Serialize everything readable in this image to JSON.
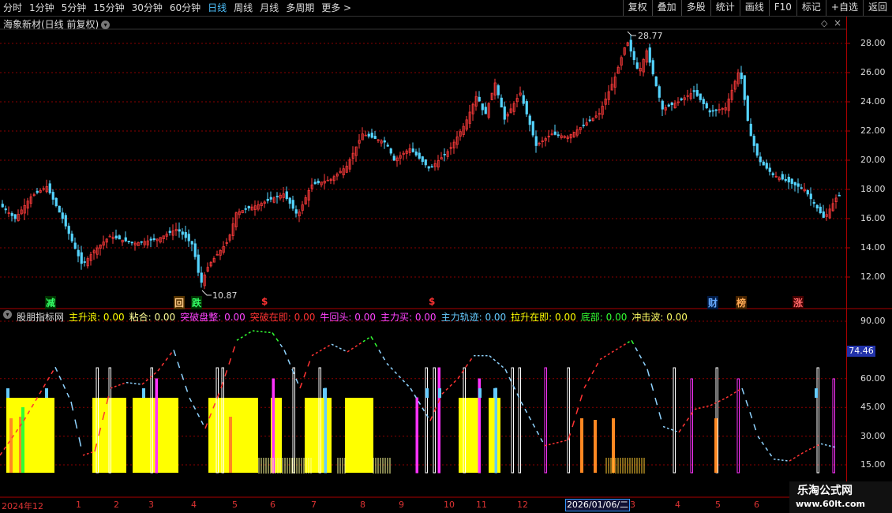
{
  "toolbar": {
    "periods": [
      "分时",
      "1分钟",
      "5分钟",
      "15分钟",
      "30分钟",
      "60分钟",
      "日线",
      "周线",
      "月线",
      "多周期",
      "更多 >"
    ],
    "active": "日线",
    "buttons": [
      "复权",
      "叠加",
      "多股",
      "统计",
      "画线",
      "F10",
      "标记",
      "+自选",
      "返回"
    ]
  },
  "stock": {
    "title": "海象新材(日线 前复权)",
    "high_label": "28.77",
    "low_label": "10.87"
  },
  "price_axis": [
    "28.00",
    "26.00",
    "24.00",
    "22.00",
    "20.00",
    "18.00",
    "16.00",
    "14.00",
    "12.00"
  ],
  "indicator": {
    "name": "股朋指标网",
    "params": [
      {
        "label": "主升浪:",
        "value": "0.00",
        "color": "#ffff00"
      },
      {
        "label": "粘合:",
        "value": "0.00",
        "color": "#ffff99"
      },
      {
        "label": "突破盘整:",
        "value": "0.00",
        "color": "#ff44ff"
      },
      {
        "label": "突破在即:",
        "value": "0.00",
        "color": "#ff3333"
      },
      {
        "label": "牛回头:",
        "value": "0.00",
        "color": "#ff44ff"
      },
      {
        "label": "主力买:",
        "value": "0.00",
        "color": "#ff44ff"
      },
      {
        "label": "主力轨迹:",
        "value": "0.00",
        "color": "#66ccff"
      },
      {
        "label": "拉升在即:",
        "value": "0.00",
        "color": "#ffff00"
      },
      {
        "label": "底部:",
        "value": "0.00",
        "color": "#33ff33"
      },
      {
        "label": "冲击波:",
        "value": "0.00",
        "color": "#ffff66"
      }
    ],
    "axis": [
      "90.00",
      "60.00",
      "45.00",
      "30.00",
      "15.00"
    ],
    "current": "74.46"
  },
  "markers": [
    {
      "text": "减",
      "color": "#33ff66",
      "bg": "#003300"
    },
    {
      "text": "回",
      "color": "#ffcc88",
      "bg": "#553300"
    },
    {
      "text": "跌",
      "color": "#33ff66",
      "bg": "#003300"
    },
    {
      "text": "$",
      "color": "#ff3333",
      "bg": ""
    },
    {
      "text": "$",
      "color": "#ff3333",
      "bg": ""
    },
    {
      "text": "财",
      "color": "#66aaff",
      "bg": "#001a44"
    },
    {
      "text": "榜",
      "color": "#ffaa55",
      "bg": "#442200"
    },
    {
      "text": "涨",
      "color": "#ff6666",
      "bg": "#440000"
    }
  ],
  "time_axis": [
    "2024年12",
    "1",
    "2",
    "3",
    "4",
    "5",
    "6",
    "7",
    "8",
    "9",
    "10",
    "11",
    "12",
    "2026/01/06/二",
    "3",
    "4",
    "5",
    "6"
  ],
  "logo": {
    "title": "乐淘公式网",
    "url": "www.60lt.com"
  }
}
